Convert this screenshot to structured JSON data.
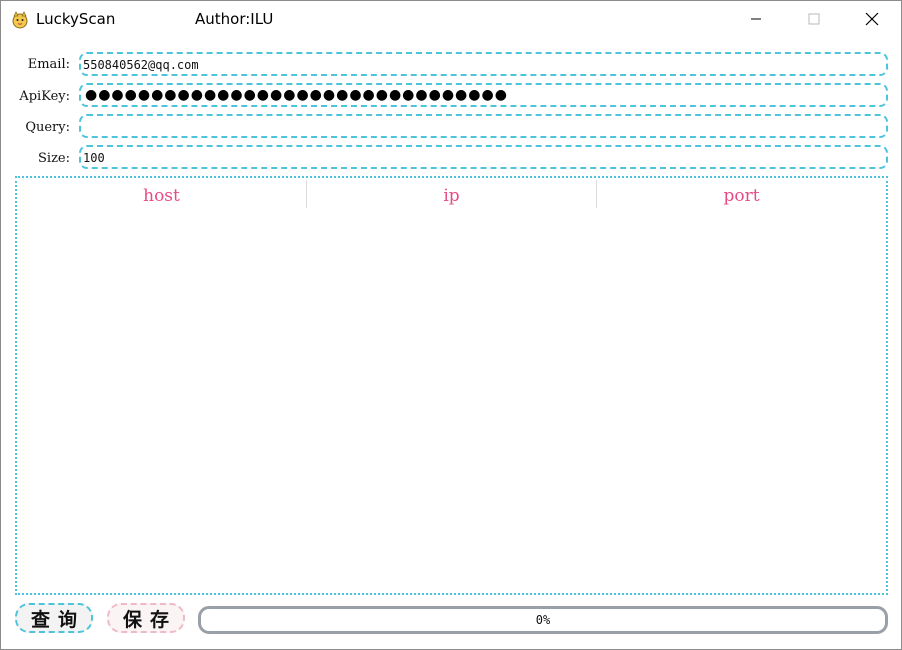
{
  "window": {
    "title": "LuckyScan",
    "author": "Author:ILU",
    "icon": "lucky-cat-icon"
  },
  "form": {
    "email_label": "Email:",
    "email_value": "550840562@qq.com",
    "apikey_label": "ApiKey:",
    "apikey_masked": "●●●●●●●●●●●●●●●●●●●●●●●●●●●●●●●●",
    "query_label": "Query:",
    "query_value": "",
    "size_label": "Size:",
    "size_value": "100"
  },
  "table": {
    "columns": [
      "host",
      "ip",
      "port"
    ],
    "rows": []
  },
  "buttons": {
    "query": "查询",
    "save": "保存"
  },
  "progress": {
    "value": 0,
    "label": "0%"
  },
  "colors": {
    "accent": "#4ec4dc",
    "header_text": "#e84a86",
    "save_border": "#f0b9c6"
  }
}
